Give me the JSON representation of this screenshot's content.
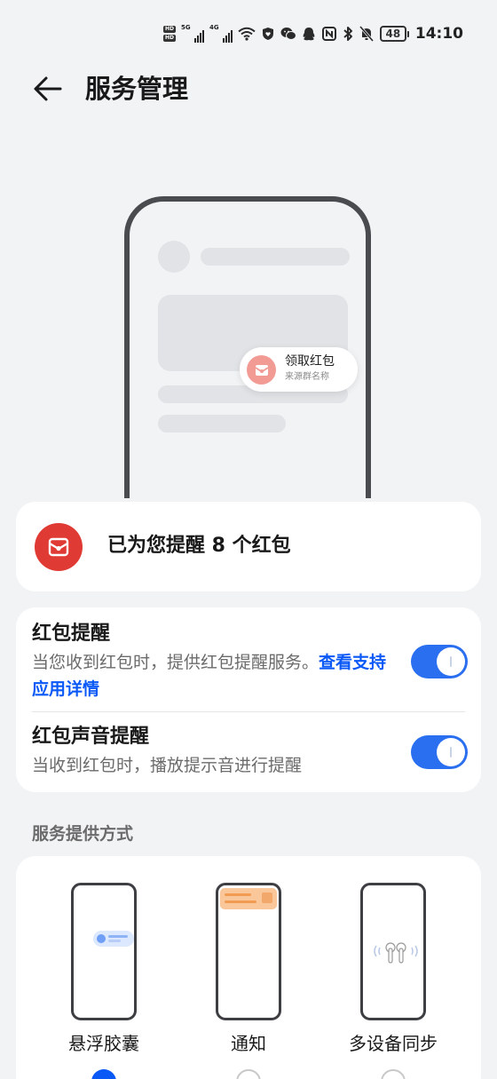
{
  "status_bar": {
    "hd_top": "HD",
    "hd_bottom": "HD",
    "sim1_tag": "5G",
    "sim2_tag": "4G",
    "battery": "48",
    "time": "14:10",
    "icons": [
      "wifi-icon",
      "shield-heart-icon",
      "wechat-icon",
      "qq-icon",
      "nfc-icon",
      "bluetooth-icon",
      "mute-bell-icon"
    ]
  },
  "header": {
    "title": "服务管理"
  },
  "illustration": {
    "capsule_title": "领取红包",
    "capsule_subtitle": "来源群名称"
  },
  "summary": {
    "text": "已为您提醒 8 个红包"
  },
  "settings": {
    "items": [
      {
        "title": "红包提醒",
        "description": "当您收到红包时，提供红包提醒服务。",
        "link": "查看支持应用详情",
        "enabled": true
      },
      {
        "title": "红包声音提醒",
        "description": "当收到红包时，播放提示音进行提醒",
        "enabled": true
      }
    ]
  },
  "service_methods": {
    "section_title": "服务提供方式",
    "options": [
      {
        "label": "悬浮胶囊",
        "selected": true
      },
      {
        "label": "通知",
        "selected": false
      },
      {
        "label": "多设备同步",
        "selected": false
      }
    ]
  },
  "colors": {
    "accent": "#0a59f7",
    "toggle_on": "#2a6ff0",
    "red_packet": "#e03a34",
    "background": "#f1f3f5"
  }
}
